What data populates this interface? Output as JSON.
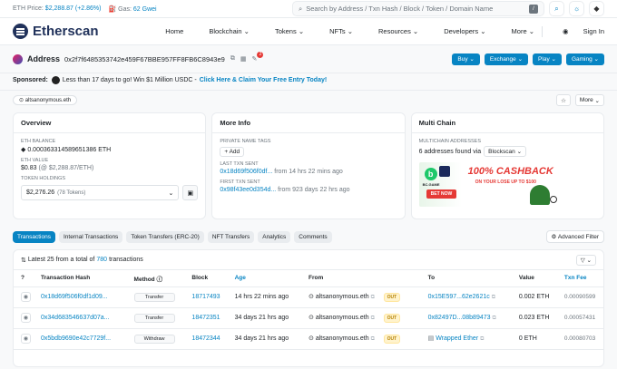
{
  "topbar": {
    "eth_price_label": "ETH Price:",
    "eth_price_value": "$2,288.87 (+2.86%)",
    "gas_label": "Gas:",
    "gas_value": "62 Gwei",
    "search_placeholder": "Search by Address / Txn Hash / Block / Token / Domain Name"
  },
  "navbar": {
    "logo_text": "Etherscan",
    "items": [
      "Home",
      "Blockchain",
      "Tokens",
      "NFTs",
      "Resources",
      "Developers",
      "More"
    ],
    "sign_in": "Sign In"
  },
  "address": {
    "label": "Address",
    "hash": "0x2f7f6485353742e459F67BBE957FF8FB6C8943e9",
    "badge_count": "2",
    "buttons": [
      "Buy",
      "Exchange",
      "Play",
      "Gaming"
    ]
  },
  "sponsored": {
    "label": "Sponsored:",
    "text": "Less than 17 days to go! Win $1 Million USDC -",
    "cta": "Click Here & Claim Your Free Entry Today!"
  },
  "name_tag": "altsanonymous.eth",
  "more_label": "More",
  "overview": {
    "title": "Overview",
    "eth_balance_label": "ETH BALANCE",
    "eth_balance": "0.000363314589651386 ETH",
    "eth_value_label": "ETH VALUE",
    "eth_value": "$0.83",
    "eth_value_rate": "(@ $2,288.87/ETH)",
    "token_holdings_label": "TOKEN HOLDINGS",
    "token_holdings": "$2,276.26",
    "token_count": "(78 Tokens)"
  },
  "more_info": {
    "title": "More Info",
    "private_tags_label": "PRIVATE NAME TAGS",
    "add_label": "+ Add",
    "last_txn_label": "LAST TXN SENT",
    "last_txn_hash": "0x18d69f506f0df...",
    "last_txn_time": "from 14 hrs 22 mins ago",
    "first_txn_label": "FIRST TXN SENT",
    "first_txn_hash": "0x98f43ee0d354d...",
    "first_txn_time": "from 923 days 22 hrs ago"
  },
  "multichain": {
    "title": "Multi Chain",
    "label": "MULTICHAIN ADDRESSES",
    "found": "6 addresses found via",
    "via": "Blockscan",
    "banner": {
      "brand": "BC.GAME",
      "headline": "100% CASHBACK",
      "sub": "ON YOUR LOSE UP TO $100",
      "cta": "BET NOW"
    }
  },
  "tabs": [
    "Transactions",
    "Internal Transactions",
    "Token Transfers (ERC-20)",
    "NFT Transfers",
    "Analytics",
    "Comments"
  ],
  "advanced_filter": "Advanced Filter",
  "txlist": {
    "summary_prefix": "Latest 25 from a total of",
    "summary_count": "780",
    "summary_suffix": "transactions",
    "columns": [
      "Transaction Hash",
      "Method",
      "Block",
      "Age",
      "From",
      "To",
      "Value",
      "Txn Fee"
    ],
    "rows": [
      {
        "hash": "0x18d69f506f0df1d09...",
        "method": "Transfer",
        "block": "18717493",
        "age": "14 hrs 22 mins ago",
        "from": "altsanonymous.eth",
        "dir": "OUT",
        "to": "0x15E597...62e2621c",
        "value": "0.002 ETH",
        "fee": "0.00090599"
      },
      {
        "hash": "0x34d683546637d07a...",
        "method": "Transfer",
        "block": "18472351",
        "age": "34 days 21 hrs ago",
        "from": "altsanonymous.eth",
        "dir": "OUT",
        "to": "0x82497D...08b89473",
        "value": "0.023 ETH",
        "fee": "0.00057431"
      },
      {
        "hash": "0x5bdb9690e42c7729f...",
        "method": "Withdraw",
        "block": "18472344",
        "age": "34 days 21 hrs ago",
        "from": "altsanonymous.eth",
        "dir": "OUT",
        "to": "Wrapped Ether",
        "value": "0 ETH",
        "fee": "0.00080703"
      }
    ]
  }
}
